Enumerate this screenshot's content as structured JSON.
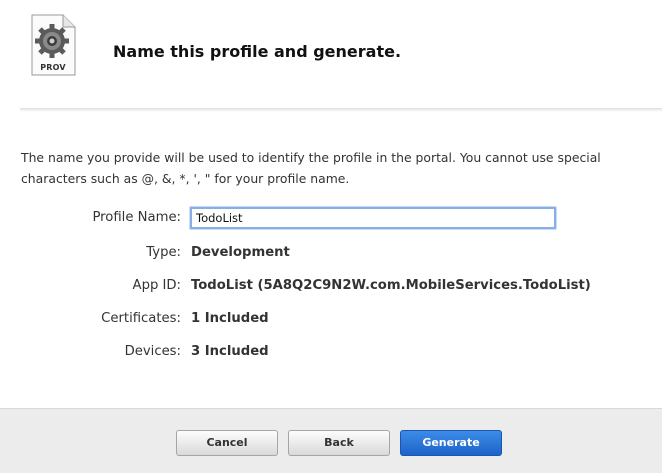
{
  "header": {
    "icon_label": "PROV",
    "title": "Name this profile and generate."
  },
  "description": "The name you provide will be used to identify the profile in the portal. You cannot use special characters such as @, &, *, ', \" for your profile name.",
  "form": {
    "profile_name": {
      "label": "Profile Name:",
      "value": "TodoList"
    },
    "type": {
      "label": "Type:",
      "value": "Development"
    },
    "app_id": {
      "label": "App ID:",
      "value": "TodoList (5A8Q2C9N2W.com.MobileServices.TodoList)"
    },
    "certificates": {
      "label": "Certificates:",
      "value": "1 Included"
    },
    "devices": {
      "label": "Devices:",
      "value": "3 Included"
    }
  },
  "footer": {
    "cancel_label": "Cancel",
    "back_label": "Back",
    "generate_label": "Generate"
  },
  "colors": {
    "primary_button": "#2a74dc",
    "input_focus_border": "#88aee6",
    "footer_bg": "#ececec"
  },
  "icons": {
    "profile_document": "gear-document-icon"
  }
}
